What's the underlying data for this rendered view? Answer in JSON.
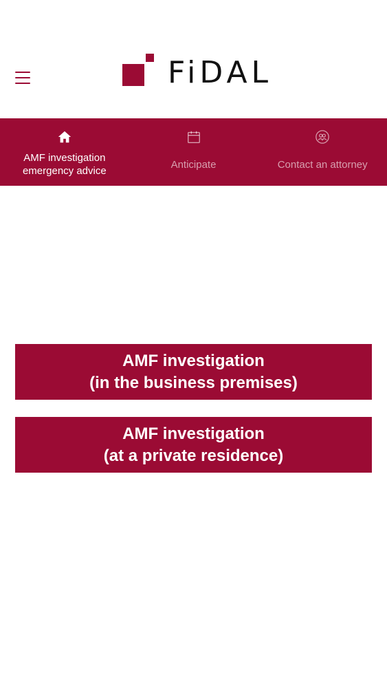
{
  "header": {
    "menu_icon": "hamburger-menu-icon",
    "logo_text": "FiDAL",
    "brand_color": "#9b0b34"
  },
  "nav": {
    "tabs": [
      {
        "label": "AMF investigation emergency advice",
        "icon": "home-icon",
        "active": true
      },
      {
        "label": "Anticipate",
        "icon": "calendar-icon",
        "active": false
      },
      {
        "label": "Contact an attorney",
        "icon": "attorney-contact-icon",
        "active": false
      }
    ]
  },
  "actions": {
    "business_premises": "AMF investigation\n(in the business premises)",
    "private_residence": "AMF investigation\n(at a private residence)"
  }
}
